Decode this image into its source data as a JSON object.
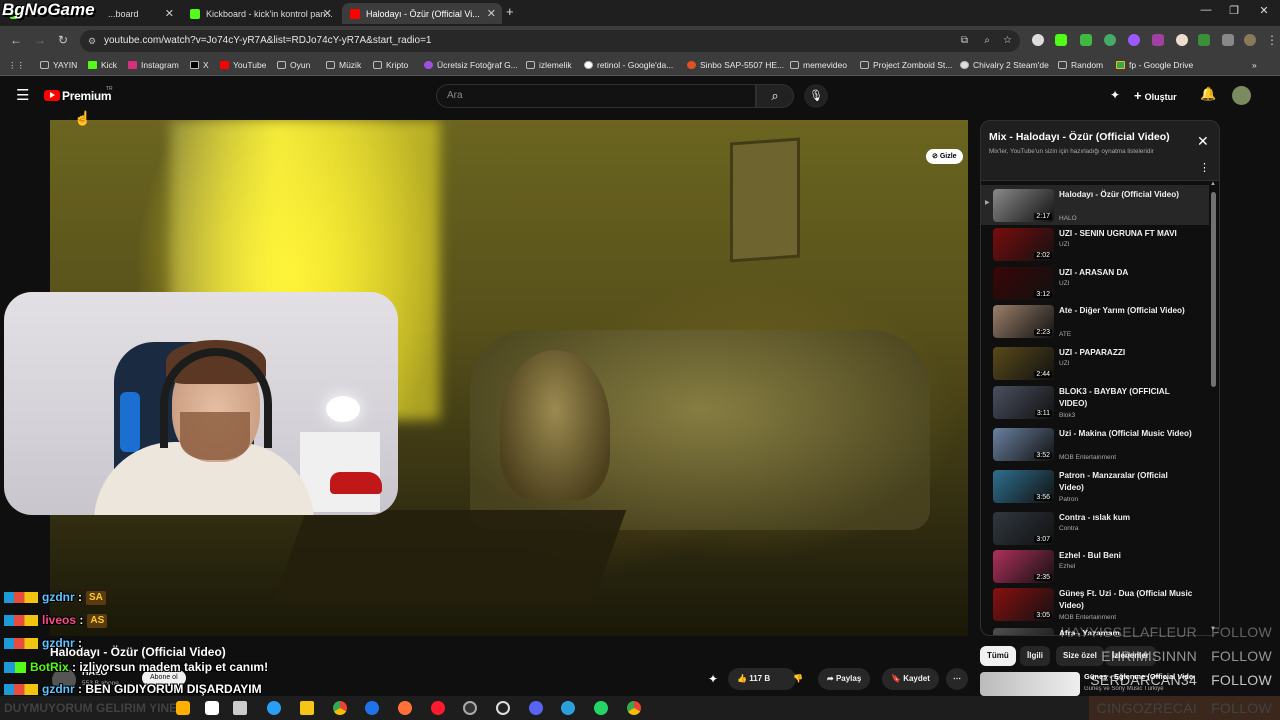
{
  "overlay": {
    "logo": "BgNoGame",
    "chat": [
      {
        "user": "gzdnr",
        "sep": " :",
        "msg": "",
        "emote": "SA",
        "user_color": "#5fc4ff"
      },
      {
        "user": "liveos",
        "sep": " :",
        "msg": "",
        "emote": "AS",
        "user_color": "#ff4a8a"
      },
      {
        "user": "gzdnr",
        "sep": " :",
        "msg": "",
        "emote": "",
        "user_color": "#5fc4ff"
      },
      {
        "user": "BotRix",
        "sep": " :",
        "msg": " izliyorsun madem takip et canım!",
        "emote": "",
        "user_color": "#53fc18"
      },
      {
        "user": "gzdnr",
        "sep": " :",
        "msg": " BEN GIDIYORUM DIŞARDAYIM",
        "emote": "",
        "user_color": "#5fc4ff"
      },
      {
        "user": "",
        "sep": "",
        "msg": "DUYMUYORUM GELIRIM YINE",
        "emote": "",
        "user_color": "#ffffff"
      }
    ],
    "follows": [
      {
        "name": "HAYYISSELAFLEUR",
        "action": "FOLLOW"
      },
      {
        "name": "EHRIMISINNN",
        "action": "FOLLOW"
      },
      {
        "name": "SERDARCAN34",
        "action": "FOLLOW"
      },
      {
        "name": "CINGOZRECAI",
        "action": "FOLLOW"
      }
    ]
  },
  "browser": {
    "tabs": [
      {
        "label": "...board"
      },
      {
        "label": "Kickboard - kick'in kontrol pan..."
      },
      {
        "label": "Halodayı - Özür (Official Vi..."
      }
    ],
    "new_tab": "+",
    "url": "youtube.com/watch?v=Jo74cY-yR7A&list=RDJo74cY-yR7A&start_radio=1",
    "bookmarks": [
      "YAYIN",
      "Kick",
      "Instagram",
      "X",
      "YouTube",
      "Oyun",
      "Müzik",
      "Kripto",
      "Ücretsiz Fotoğraf G...",
      "izlemelik",
      "retinol - Google'da...",
      "Sinbo SAP-5507 HE...",
      "memevideo",
      "Project Zomboid St...",
      "Chivalry 2 Steam'de",
      "Random",
      "fp - Google Drive"
    ],
    "bookmarks_more": "»"
  },
  "youtube": {
    "logo_text": "Premium",
    "logo_sup": "TR",
    "search_placeholder": "Ara",
    "create_label": "Oluştur",
    "hide_label": "Gizle",
    "video_title": "Halodayı - Özür (Official Video)",
    "channel": "HALO",
    "subscribers": "553 B abone",
    "subscribe_label": "Abone ol",
    "like_count": "117 B",
    "share_label": "Paylaş",
    "save_label": "Kaydet",
    "more_label": "⋯",
    "chips": [
      "Tümü",
      "İlgili",
      "Size özel",
      "İzlenenler"
    ],
    "next_item": {
      "title": "Güneş - Eğlenme (Official Video)",
      "channel": "Güneş ve Sony Music Türkiye"
    }
  },
  "playlist": {
    "title": "Mix - Halodayı - Özür (Official Video)",
    "subtitle": "Mix'ler, YouTube'un sizin için hazırladığı oynatma listeleridir",
    "items": [
      {
        "title": "Halodayı - Özür (Official Video)",
        "channel": "HALO",
        "duration": "2:17",
        "color": "#8a8a8a"
      },
      {
        "title": "UZI - SENIN UGRUNA FT MAVI",
        "channel": "UZI",
        "duration": "2:02",
        "color": "#7a0c0c"
      },
      {
        "title": "UZI - ARASAN DA",
        "channel": "UZI",
        "duration": "3:12",
        "color": "#3a0606"
      },
      {
        "title": "Ate - Diğer Yarım (Official Video)",
        "channel": "ATE",
        "duration": "2:23",
        "color": "#9a7f6a"
      },
      {
        "title": "UZI - PAPARAZZI",
        "channel": "UZI",
        "duration": "2:44",
        "color": "#5a4a1a"
      },
      {
        "title": "BLOK3 - BAYBAY (OFFICIAL VIDEO)",
        "channel": "Blok3",
        "duration": "3:11",
        "color": "#4a5060"
      },
      {
        "title": "Uzi - Makina (Official Music Video)",
        "channel": "MOB Entertainment",
        "duration": "3:52",
        "color": "#6a80a0"
      },
      {
        "title": "Patron - Manzaralar (Official Video)",
        "channel": "Patron",
        "duration": "3:56",
        "color": "#2f6f8f"
      },
      {
        "title": "Contra - ıslak kum",
        "channel": "Contra",
        "duration": "3:07",
        "color": "#303840"
      },
      {
        "title": "Ezhel - Bul Beni",
        "channel": "Ezhel",
        "duration": "2:35",
        "color": "#b0305a"
      },
      {
        "title": "Güneş Ft. Uzi - Dua (Official Music Video)",
        "channel": "MOB Entertainment",
        "duration": "3:05",
        "color": "#8a1010"
      },
      {
        "title": "Afra - Yazamam",
        "channel": "",
        "duration": "",
        "color": "#505050"
      }
    ]
  },
  "colors": {
    "accent_red": "#ff0000",
    "kick_green": "#53fc18"
  },
  "icons": [
    "back-icon",
    "forward-icon",
    "reload-icon",
    "search-icon",
    "mic-icon",
    "bell-icon",
    "close-icon",
    "like-icon",
    "dislike-icon",
    "share-icon",
    "save-icon",
    "menu-icon"
  ]
}
